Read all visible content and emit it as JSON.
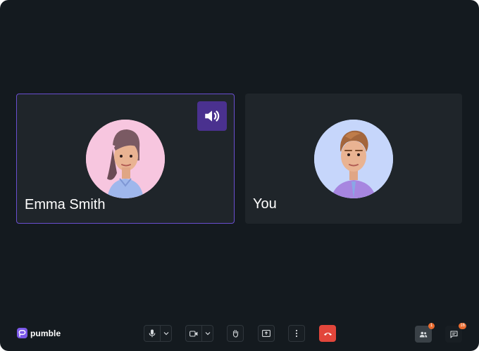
{
  "participants": [
    {
      "name": "Emma Smith",
      "speaking": true
    },
    {
      "name": "You",
      "speaking": false
    }
  ],
  "brand": {
    "name": "pumble"
  },
  "controls": {
    "mic_icon": "microphone-icon",
    "camera_icon": "camera-icon",
    "raise_hand_icon": "hand-icon",
    "share_screen_icon": "share-screen-icon",
    "more_icon": "more-vertical-icon",
    "leave_icon": "phone-hangup-icon"
  },
  "sidebar": {
    "people_badge": "1",
    "chat_badge": "16"
  },
  "colors": {
    "background": "#141a1f",
    "tile": "#1f252a",
    "active_border": "#6a4fd0",
    "speaker_button": "#4a318f",
    "leave": "#e2463b",
    "badge": "#e86a2e",
    "brand": "#7b58e8"
  }
}
